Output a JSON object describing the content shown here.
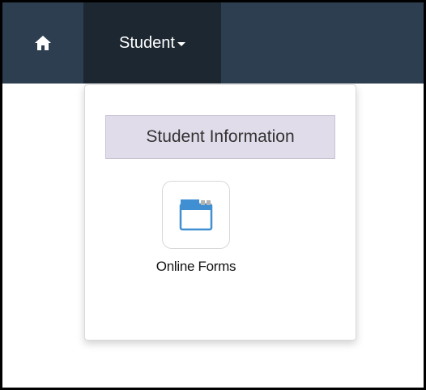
{
  "navbar": {
    "home_icon": "home-icon",
    "menu_label": "Student",
    "background": "#2c3e50",
    "active_background": "#1c2731"
  },
  "dropdown": {
    "section_title": "Student Information",
    "items": [
      {
        "label": "Online Forms",
        "icon": "window-icon",
        "icon_color": "#3f8fd2"
      }
    ]
  }
}
